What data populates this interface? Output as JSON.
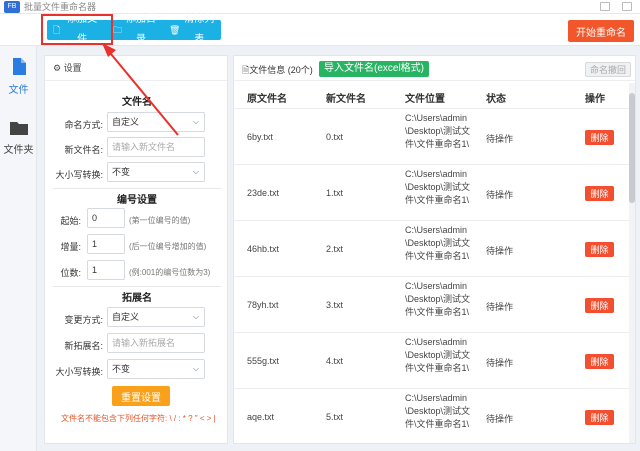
{
  "window": {
    "title": "批量文件重命名器"
  },
  "toolbar": {
    "add_file": "添加文件",
    "add_dir": "添加目录",
    "clear_list": "清除列表",
    "start_rename": "开始重命名"
  },
  "nav": [
    {
      "label": "文件",
      "icon": "file-icon"
    },
    {
      "label": "文件夹",
      "icon": "folder-icon"
    }
  ],
  "settings": {
    "header": "设置",
    "filename_section": "文件名",
    "naming_mode_label": "命名方式:",
    "naming_mode_value": "自定义",
    "new_name_label": "新文件名:",
    "new_name_placeholder": "请输入新文件名",
    "case_label": "大小写转换:",
    "case_value": "不变",
    "number_section": "编号设置",
    "start_label": "起始:",
    "start_value": "0",
    "start_hint": "(第一位编号的值)",
    "step_label": "增量:",
    "step_value": "1",
    "step_hint": "(后一位编号增加的值)",
    "digits_label": "位数:",
    "digits_value": "1",
    "digits_hint": "(例:001的编号位数为3)",
    "ext_section": "拓展名",
    "ext_mode_label": "变更方式:",
    "ext_mode_value": "自定义",
    "new_ext_label": "新拓展名:",
    "new_ext_placeholder": "请输入新拓展名",
    "ext_case_label": "大小写转换:",
    "ext_case_value": "不变",
    "reset_button": "重置设置",
    "warning": "文件名不能包含下列任何字符: \\ / : * ? \" < > |"
  },
  "main": {
    "info_label": "文件信息",
    "count": "(20个)",
    "import_button": "导入文件名(excel格式)",
    "undo_button": "命名撤回",
    "columns": [
      "原文件名",
      "新文件名",
      "文件位置",
      "状态",
      "操作"
    ],
    "rows": [
      {
        "original": "6by.txt",
        "new": "0.txt",
        "path": "C:\\Users\\admin\\Desktop\\测试文件\\文件重命名1\\",
        "status": "待操作",
        "action": "删除"
      },
      {
        "original": "23de.txt",
        "new": "1.txt",
        "path": "C:\\Users\\admin\\Desktop\\测试文件\\文件重命名1\\",
        "status": "待操作",
        "action": "删除"
      },
      {
        "original": "46hb.txt",
        "new": "2.txt",
        "path": "C:\\Users\\admin\\Desktop\\测试文件\\文件重命名1\\",
        "status": "待操作",
        "action": "删除"
      },
      {
        "original": "78yh.txt",
        "new": "3.txt",
        "path": "C:\\Users\\admin\\Desktop\\测试文件\\文件重命名1\\",
        "status": "待操作",
        "action": "删除"
      },
      {
        "original": "555g.txt",
        "new": "4.txt",
        "path": "C:\\Users\\admin\\Desktop\\测试文件\\文件重命名1\\",
        "status": "待操作",
        "action": "删除"
      },
      {
        "original": "aqe.txt",
        "new": "5.txt",
        "path": "C:\\Users\\admin\\Desktop\\测试文件\\文件重命名1\\",
        "status": "待操作",
        "action": "删除"
      }
    ]
  },
  "colors": {
    "toolbar_blue": "#1bb1e4",
    "start_orange": "#f2562b",
    "import_green": "#28b463",
    "delete_red": "#f14f2f",
    "reset_orange": "#f9a11b",
    "highlight_red": "#e8322d"
  }
}
